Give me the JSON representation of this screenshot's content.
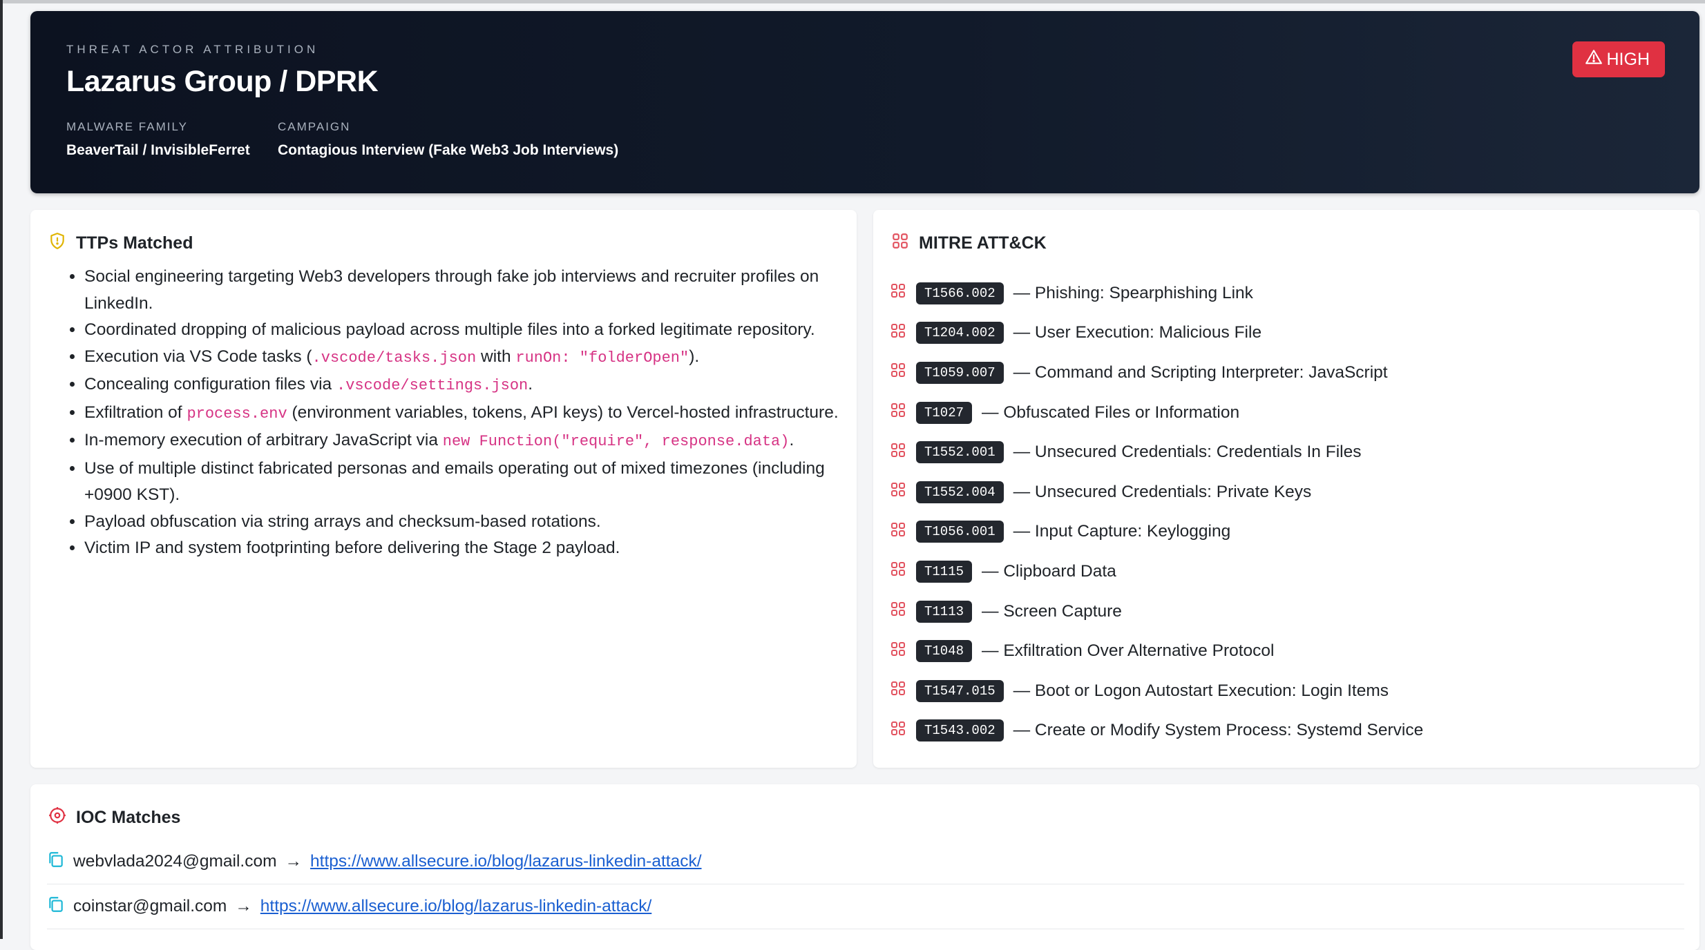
{
  "header": {
    "eyebrow": "THREAT ACTOR ATTRIBUTION",
    "title": "Lazarus Group / DPRK",
    "malware_label": "MALWARE FAMILY",
    "malware_value": "BeaverTail / InvisibleFerret",
    "campaign_label": "CAMPAIGN",
    "campaign_value": "Contagious Interview (Fake Web3 Job Interviews)",
    "severity": "HIGH"
  },
  "ttps": {
    "title": "TTPs Matched",
    "items": [
      {
        "parts": [
          {
            "t": "Social engineering targeting Web3 developers through fake job interviews and recruiter profiles on LinkedIn."
          }
        ]
      },
      {
        "parts": [
          {
            "t": "Coordinated dropping of malicious payload across multiple files into a forked legitimate repository."
          }
        ]
      },
      {
        "parts": [
          {
            "t": "Execution via VS Code tasks ("
          },
          {
            "t": ".vscode/tasks.json",
            "code": true
          },
          {
            "t": " with "
          },
          {
            "t": "runOn: \"folderOpen\"",
            "code": true
          },
          {
            "t": ")."
          }
        ]
      },
      {
        "parts": [
          {
            "t": "Concealing configuration files via "
          },
          {
            "t": ".vscode/settings.json",
            "code": true
          },
          {
            "t": "."
          }
        ]
      },
      {
        "parts": [
          {
            "t": "Exfiltration of "
          },
          {
            "t": "process.env",
            "code": true
          },
          {
            "t": " (environment variables, tokens, API keys) to Vercel-hosted infrastructure."
          }
        ]
      },
      {
        "parts": [
          {
            "t": "In-memory execution of arbitrary JavaScript via "
          },
          {
            "t": "new Function(\"require\", response.data)",
            "code": true
          },
          {
            "t": "."
          }
        ]
      },
      {
        "parts": [
          {
            "t": "Use of multiple distinct fabricated personas and emails operating out of mixed timezones (including +0900 KST)."
          }
        ]
      },
      {
        "parts": [
          {
            "t": "Payload obfuscation via string arrays and checksum-based rotations."
          }
        ]
      },
      {
        "parts": [
          {
            "t": "Victim IP and system footprinting before delivering the Stage 2 payload."
          }
        ]
      }
    ]
  },
  "mitre": {
    "title": "MITRE ATT&CK",
    "items": [
      {
        "id": "T1566.002",
        "name": "— Phishing: Spearphishing Link"
      },
      {
        "id": "T1204.002",
        "name": "— User Execution: Malicious File"
      },
      {
        "id": "T1059.007",
        "name": "— Command and Scripting Interpreter: JavaScript"
      },
      {
        "id": "T1027",
        "name": "— Obfuscated Files or Information"
      },
      {
        "id": "T1552.001",
        "name": "— Unsecured Credentials: Credentials In Files"
      },
      {
        "id": "T1552.004",
        "name": "— Unsecured Credentials: Private Keys"
      },
      {
        "id": "T1056.001",
        "name": "— Input Capture: Keylogging"
      },
      {
        "id": "T1115",
        "name": "— Clipboard Data"
      },
      {
        "id": "T1113",
        "name": "— Screen Capture"
      },
      {
        "id": "T1048",
        "name": "— Exfiltration Over Alternative Protocol"
      },
      {
        "id": "T1547.015",
        "name": "— Boot or Logon Autostart Execution: Login Items"
      },
      {
        "id": "T1543.002",
        "name": "— Create or Modify System Process: Systemd Service"
      }
    ]
  },
  "ioc": {
    "title": "IOC Matches",
    "items": [
      {
        "indicator": "webvlada2024@gmail.com",
        "arrow": "→",
        "url": "https://www.allsecure.io/blog/lazarus-linkedin-attack/"
      },
      {
        "indicator": "coinstar@gmail.com",
        "arrow": "→",
        "url": "https://www.allsecure.io/blog/lazarus-linkedin-attack/"
      }
    ]
  },
  "colors": {
    "header_bg": "#0c1220",
    "severity_bg": "#e03142",
    "code_text": "#d63384",
    "technique_badge_bg": "#23272e",
    "link": "#1a5fd1",
    "shield_icon": "#e0b400",
    "grid_icon": "#e2525f",
    "target_icon": "#e03142",
    "copy_icon": "#1bb7d6"
  }
}
